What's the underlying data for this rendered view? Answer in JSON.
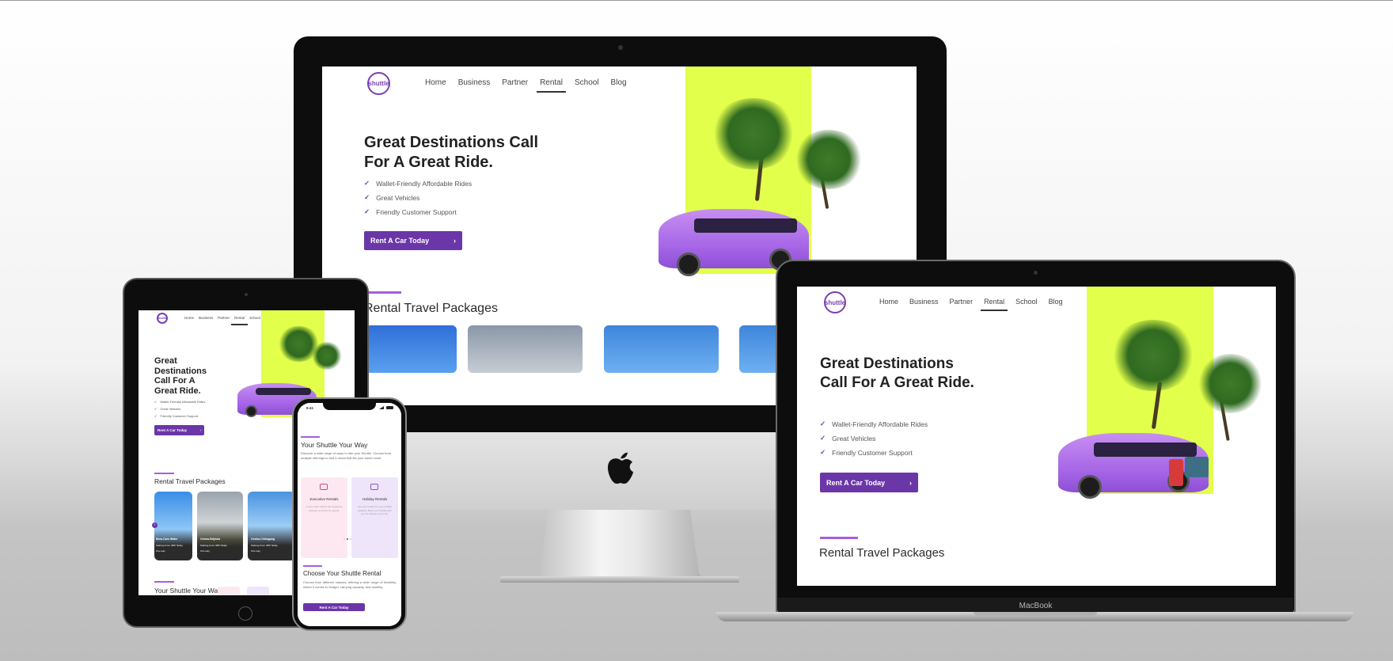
{
  "site": {
    "logo_text": "shuttle",
    "nav": [
      "Home",
      "Business",
      "Partner",
      "Rental",
      "School",
      "Blog"
    ],
    "active_nav": "Rental",
    "hero_title": "Great Destinations Call For A Great Ride.",
    "features": [
      "Wallet-Friendly Affordable Rides",
      "Great Vehicles",
      "Friendly Customer Support"
    ],
    "cta_label": "Rent A Car Today",
    "section_title": "Rental Travel Packages"
  },
  "tablet": {
    "cards": [
      {
        "title": "Bora-Cars Water",
        "line1": "Starting From 3857 $/day",
        "line2": "One way"
      },
      {
        "title": "Orsina-Brijisha",
        "line1": "Starting From 3857 $/day",
        "line2": "One way"
      },
      {
        "title": "Orsina-Chikagang",
        "line1": "Starting From 3857 $/day",
        "line2": "One way"
      }
    ],
    "section2_title": "Your Shuttle Your Way"
  },
  "phone": {
    "status_time": "9:41",
    "section_title": "Your Shuttle Your Way",
    "section_desc": "Discover a wide range of ways to ride your Shuttle. Choose from multiple offerings to find a rental that fits your travel mode.",
    "cards": [
      {
        "title": "Executive Rentals",
        "desc": "Luxury rides without the expensive ordering, and best for guests."
      },
      {
        "title": "Holiday Rentals",
        "desc": "Get your reason for your holiday getaway. Book your Shuttle with you for driving to your trip."
      }
    ],
    "choose_title": "Choose Your Shuttle Rental",
    "choose_desc": "Choose from different classes, offering a wide range of flexibility, where it comes to budget, carrying capacity, and mobility.",
    "cta_label": "Rent A Car Today"
  },
  "laptop": {
    "brand": "MacBook"
  },
  "colors": {
    "accent": "#6b36a8",
    "accent_light": "#a35fe0",
    "hero_bg": "#e2ff4b",
    "van": "#a868e8"
  }
}
